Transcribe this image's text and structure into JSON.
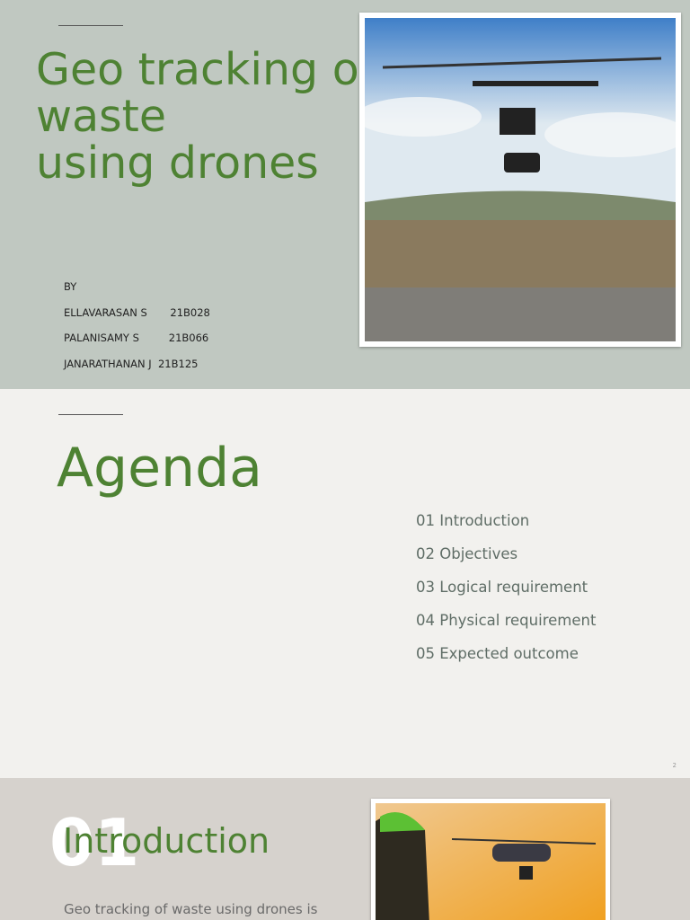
{
  "slide1": {
    "title": "Geo tracking of\nwaste\nusing drones",
    "authors": [
      "BY",
      "ELLAVARASAN S       21B028",
      "PALANISAMY S         21B066",
      "JANARATHANAN J  21B125"
    ]
  },
  "slide2": {
    "title": "Agenda",
    "items": [
      "01 Introduction",
      "02 Objectives",
      "03 Logical requirement",
      "04 Physical requirement",
      "05 Expected outcome"
    ],
    "page_number": "2"
  },
  "slide3": {
    "number": "01",
    "title": "Introduction",
    "text": "Geo tracking of waste using drones is"
  }
}
